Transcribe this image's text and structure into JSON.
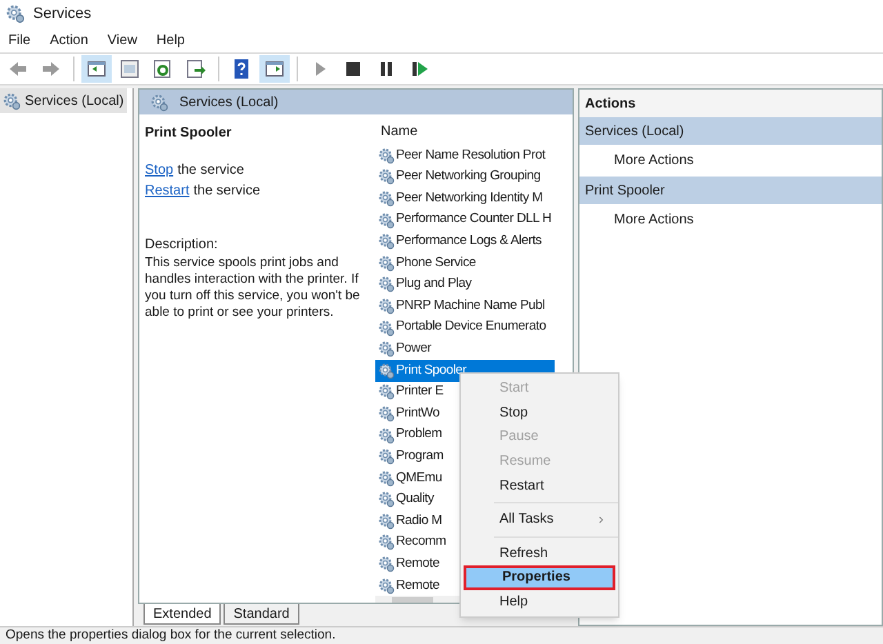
{
  "window": {
    "title": "Services"
  },
  "menu_bar": [
    "File",
    "Action",
    "View",
    "Help"
  ],
  "toolbar": [
    {
      "kind": "back",
      "disabled": true
    },
    {
      "kind": "forward",
      "disabled": true
    },
    {
      "kind": "separator"
    },
    {
      "kind": "tree",
      "selected": true
    },
    {
      "kind": "window",
      "selected": false
    },
    {
      "kind": "refresh",
      "selected": false
    },
    {
      "kind": "export",
      "selected": false
    },
    {
      "kind": "separator"
    },
    {
      "kind": "help",
      "selected": false
    },
    {
      "kind": "pane",
      "selected": true
    },
    {
      "kind": "separator"
    },
    {
      "kind": "play",
      "disabled": true
    },
    {
      "kind": "stop",
      "disabled": false
    },
    {
      "kind": "pause",
      "disabled": false
    },
    {
      "kind": "resume",
      "disabled": false
    }
  ],
  "tree": {
    "items": [
      {
        "label": "Services (Local)",
        "selected": true
      }
    ]
  },
  "center": {
    "header": "Services (Local)",
    "service_name": "Print Spooler",
    "actions": [
      {
        "link": "Stop",
        "text": "the service"
      },
      {
        "link": "Restart",
        "text": "the service"
      }
    ],
    "description_label": "Description:",
    "description": "This service spools print jobs and handles interaction with the printer. If you turn off this service, you won't be able to print or see your printers.",
    "list": {
      "column": "Name",
      "rows": [
        {
          "name": "Peer Name Resolution Prot",
          "selected": false
        },
        {
          "name": "Peer Networking Grouping",
          "selected": false
        },
        {
          "name": "Peer Networking Identity M",
          "selected": false
        },
        {
          "name": "Performance Counter DLL H",
          "selected": false
        },
        {
          "name": "Performance Logs & Alerts",
          "selected": false
        },
        {
          "name": "Phone Service",
          "selected": false
        },
        {
          "name": "Plug and Play",
          "selected": false
        },
        {
          "name": "PNRP Machine Name Publ",
          "selected": false
        },
        {
          "name": "Portable Device Enumerato",
          "selected": false
        },
        {
          "name": "Power",
          "selected": false
        },
        {
          "name": "Print Spooler",
          "selected": true
        },
        {
          "name": "Printer E",
          "selected": false
        },
        {
          "name": "PrintWo",
          "selected": false
        },
        {
          "name": "Problem",
          "selected": false
        },
        {
          "name": "Program",
          "selected": false
        },
        {
          "name": "QMEmu",
          "selected": false
        },
        {
          "name": "Quality",
          "selected": false
        },
        {
          "name": "Radio M",
          "selected": false
        },
        {
          "name": "Recomm",
          "selected": false
        },
        {
          "name": "Remote",
          "selected": false
        },
        {
          "name": "Remote",
          "selected": false
        }
      ]
    },
    "tabs": [
      {
        "label": "Extended",
        "selected": true
      },
      {
        "label": "Standard",
        "selected": false
      }
    ]
  },
  "actions_pane": {
    "title": "Actions",
    "sections": [
      {
        "title": "Services (Local)",
        "items": [
          "More Actions"
        ]
      },
      {
        "title": "Print Spooler",
        "items": [
          "More Actions"
        ]
      }
    ]
  },
  "context_menu": [
    {
      "kind": "item",
      "label": "Start",
      "disabled": true,
      "highlighted": false
    },
    {
      "kind": "item",
      "label": "Stop",
      "disabled": false,
      "highlighted": false
    },
    {
      "kind": "item",
      "label": "Pause",
      "disabled": true,
      "highlighted": false
    },
    {
      "kind": "item",
      "label": "Resume",
      "disabled": true,
      "highlighted": false
    },
    {
      "kind": "item",
      "label": "Restart",
      "disabled": false,
      "highlighted": false
    },
    {
      "kind": "separator"
    },
    {
      "kind": "submenu",
      "label": "All Tasks",
      "disabled": false,
      "highlighted": false
    },
    {
      "kind": "separator"
    },
    {
      "kind": "item",
      "label": "Refresh",
      "disabled": false,
      "highlighted": false
    },
    {
      "kind": "item",
      "label": "Properties",
      "disabled": false,
      "highlighted": true
    },
    {
      "kind": "item",
      "label": "Help",
      "disabled": false,
      "highlighted": false
    }
  ],
  "status_bar": "Opens the properties dialog box for the current selection."
}
